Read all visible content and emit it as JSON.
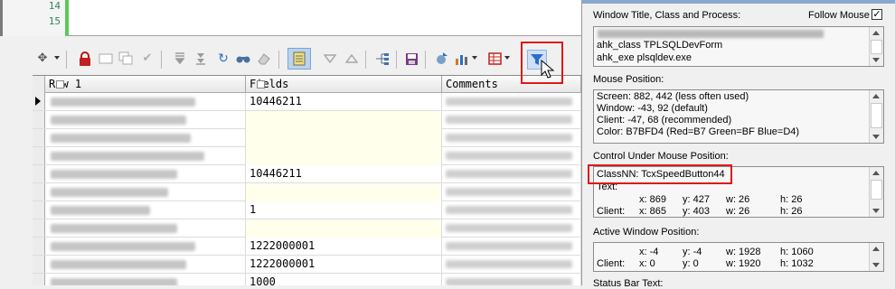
{
  "editor": {
    "line_numbers": [
      "14",
      "15"
    ]
  },
  "grid": {
    "headers": [
      "Row 1",
      "Fields",
      "Comments"
    ],
    "fields_values": [
      "10446211",
      "",
      "",
      "",
      "10446211",
      "",
      "1",
      "",
      "1222000001",
      "1222000001",
      "1000"
    ],
    "yellow_rows": [
      1,
      2,
      3,
      5,
      7
    ]
  },
  "toolbar": {
    "icons": [
      "grid-options-icon",
      "lock-icon",
      "clear-icon",
      "duplicate-icon",
      "post-icon",
      "next-record-icon",
      "last-record-icon",
      "refresh-icon",
      "find-icon",
      "eraser-icon",
      "single-record-view-icon",
      "previous-icon",
      "next-icon",
      "query-by-example-icon",
      "save-icon",
      "export-icon",
      "chart-icon",
      "table-icon",
      "filter-icon"
    ]
  },
  "spy": {
    "title_section_label": "Window Title, Class and Process:",
    "follow_mouse_label": "Follow Mouse",
    "follow_mouse_checked": "✓",
    "title_lines": [
      "ahk_class TPLSQLDevForm",
      "ahk_exe plsqldev.exe"
    ],
    "mouse_section_label": "Mouse Position:",
    "mouse_lines": [
      "Screen:  882, 442 (less often used)",
      "Window:  -43, 92 (default)",
      "Client:  -47, 68 (recommended)",
      "Color:    B7BFD4 (Red=B7 Green=BF Blue=D4)"
    ],
    "control_section_label": "Control Under Mouse Position:",
    "control_classnn": "ClassNN:  TcxSpeedButton44",
    "control_text_label": "Text:",
    "control_screen": {
      "x": "x: 869",
      "y": "y: 427",
      "w": "w: 26",
      "h": "h: 26"
    },
    "control_client": {
      "label": "Client:",
      "x": "x: 865",
      "y": "y: 403",
      "w": "w: 26",
      "h": "h: 26"
    },
    "active_section_label": "Active Window Position:",
    "active_screen": {
      "x": "x: -4",
      "y": "y: -4",
      "w": "w: 1928",
      "h": "h: 1060"
    },
    "active_client": {
      "label": "Client:",
      "x": "x: 0",
      "y": "y: 0",
      "w": "w: 1920",
      "h": "h: 1032"
    },
    "status_section_label": "Status Bar Text:"
  }
}
